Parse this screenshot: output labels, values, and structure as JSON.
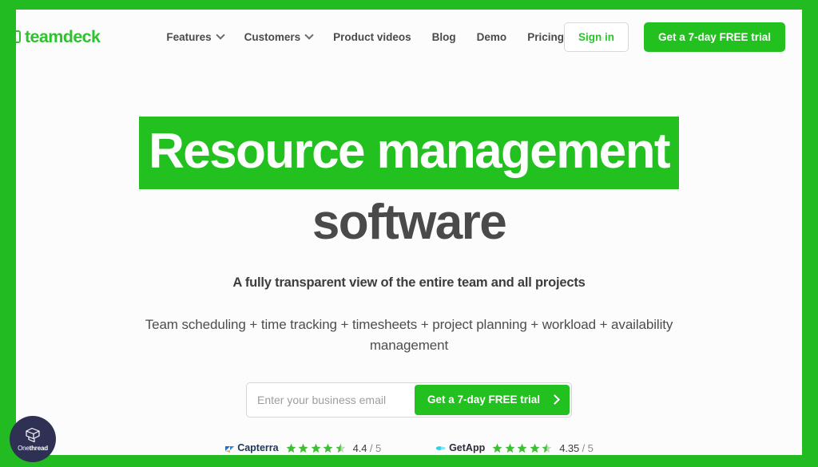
{
  "colors": {
    "brand_green": "#22c11f",
    "logo_green": "#2ec22e",
    "frame_green": "#22bb22",
    "headline_dark": "#4a4a4a",
    "badge_navy": "#2e3054",
    "star_green": "#3fbf34"
  },
  "header": {
    "logo": {
      "text": "teamdeck",
      "mark": "teamdeck-square-mark"
    },
    "nav": [
      {
        "label": "Features",
        "has_dropdown": true
      },
      {
        "label": "Customers",
        "has_dropdown": true
      },
      {
        "label": "Product videos",
        "has_dropdown": false
      },
      {
        "label": "Blog",
        "has_dropdown": false
      },
      {
        "label": "Demo",
        "has_dropdown": false
      },
      {
        "label": "Pricing",
        "has_dropdown": false
      }
    ],
    "sign_in_label": "Sign in",
    "trial_label": "Get a 7-day FREE trial"
  },
  "hero": {
    "headline_highlight": "Resource management",
    "headline_rest": "software",
    "subheadline": "A fully transparent view of the entire team and all projects",
    "description": "Team scheduling + time tracking + timesheets + project planning + workload + availability management"
  },
  "signup": {
    "email_placeholder": "Enter your business email",
    "email_value": "",
    "cta_label": "Get a 7-day FREE trial",
    "cta_arrow": "chevron-right-icon"
  },
  "ratings": [
    {
      "brand": "Capterra",
      "icon": "capterra-flag-icon",
      "stars_filled": 4,
      "stars_half": true,
      "score": "4.4",
      "separator": "/",
      "out_of": "5"
    },
    {
      "brand": "GetApp",
      "icon": "getapp-swoosh-icon",
      "stars_filled": 4,
      "stars_half": true,
      "score": "4.35",
      "separator": "/",
      "out_of": "5"
    }
  ],
  "watermark": {
    "name_light": "One",
    "name_bold": "thread",
    "icon": "onethread-cube-icon"
  }
}
